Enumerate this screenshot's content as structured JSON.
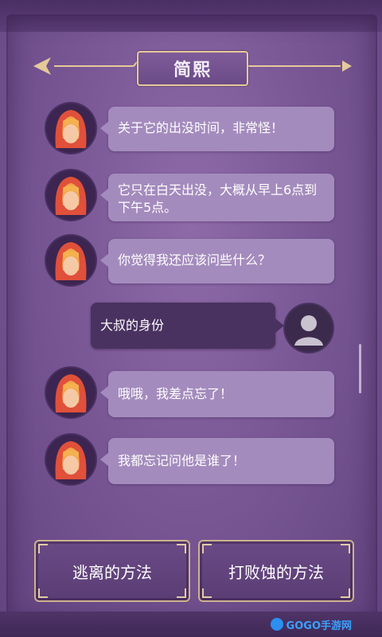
{
  "header": {
    "title": "简熙"
  },
  "messages": [
    {
      "speaker": "npc",
      "text": "关于它的出没时间，非常怪！"
    },
    {
      "speaker": "npc",
      "text": "它只在白天出没，大概从早上6点到下午5点。"
    },
    {
      "speaker": "npc",
      "text": "你觉得我还应该问些什么？"
    },
    {
      "speaker": "player",
      "text": "大叔的身份"
    },
    {
      "speaker": "npc",
      "text": "哦哦，我差点忘了！"
    },
    {
      "speaker": "npc",
      "text": "我都忘记问他是谁了！"
    }
  ],
  "choices": [
    {
      "label": "逃离的方法"
    },
    {
      "label": "打败蚀的方法"
    }
  ],
  "watermark": {
    "text": "GOGO手游网"
  },
  "colors": {
    "npc_bubble": "#a48bbd",
    "player_bubble": "#4a3260",
    "gold_trim": "#e6c99a",
    "hood_red": "#e0503a"
  }
}
